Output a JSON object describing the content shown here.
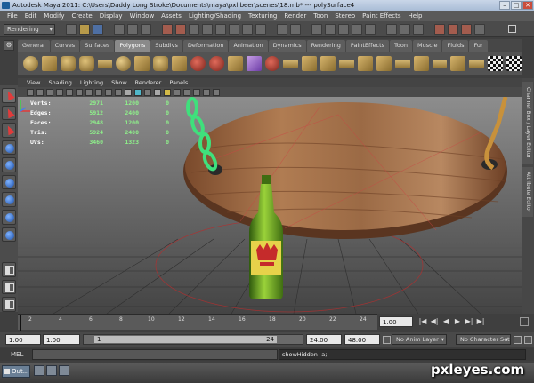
{
  "title": "Autodesk Maya 2011: C:\\Users\\Daddy Long Stroke\\Documents\\maya\\pxl beer\\scenes\\18.mb*   ---   polySurface4",
  "window_controls": {
    "minimize": "–",
    "maximize": "□",
    "close": "✕"
  },
  "menu": [
    "File",
    "Edit",
    "Modify",
    "Create",
    "Display",
    "Window",
    "Assets",
    "Lighting/Shading",
    "Texturing",
    "Render",
    "Toon",
    "Stereo",
    "Paint Effects",
    "Help"
  ],
  "status_line": {
    "mode": "Rendering"
  },
  "shelf_tabs": [
    "General",
    "Curves",
    "Surfaces",
    "Polygons",
    "Subdivs",
    "Deformation",
    "Animation",
    "Dynamics",
    "Rendering",
    "PaintEffects",
    "Toon",
    "Muscle",
    "Fluids",
    "Fur"
  ],
  "active_shelf_tab": "Polygons",
  "panel_menu": [
    "View",
    "Shading",
    "Lighting",
    "Show",
    "Renderer",
    "Panels"
  ],
  "hud": {
    "rows": [
      {
        "label": "Verts:",
        "v1": "2971",
        "v2": "1200",
        "v3": "0"
      },
      {
        "label": "Edges:",
        "v1": "5912",
        "v2": "2400",
        "v3": "0"
      },
      {
        "label": "Faces:",
        "v1": "2948",
        "v2": "1200",
        "v3": "0"
      },
      {
        "label": "Tris:",
        "v1": "5924",
        "v2": "2400",
        "v3": "0"
      },
      {
        "label": "UVs:",
        "v1": "3460",
        "v2": "1323",
        "v3": "0"
      }
    ]
  },
  "side_tabs": [
    "Channel Box / Layer Editor",
    "Attribute Editor"
  ],
  "time_slider": {
    "ticks": [
      "2",
      "4",
      "6",
      "8",
      "10",
      "12",
      "14",
      "16",
      "18",
      "20",
      "22",
      "24"
    ],
    "current_frame": "1.00"
  },
  "playback_controls": [
    "|◀",
    "◀|",
    "◀",
    "▶",
    "▶|",
    "▶|"
  ],
  "range": {
    "start_time": "1.00",
    "playback_start": "1.00",
    "range_start_label": "1",
    "range_end_label": "24",
    "playback_end": "24.00",
    "end_time": "48.00",
    "anim_layer": "No Anim Layer",
    "character_set": "No Character Set"
  },
  "command_line": {
    "label": "MEL",
    "result": "showHidden -a;"
  },
  "taskbar": {
    "button": "Out..."
  },
  "watermark": "pxleyes.com",
  "colors": {
    "hud": "#8ef08a",
    "wood": "#9b6a45",
    "bottle": "#6aa11f",
    "chain": "#3fe07c"
  }
}
